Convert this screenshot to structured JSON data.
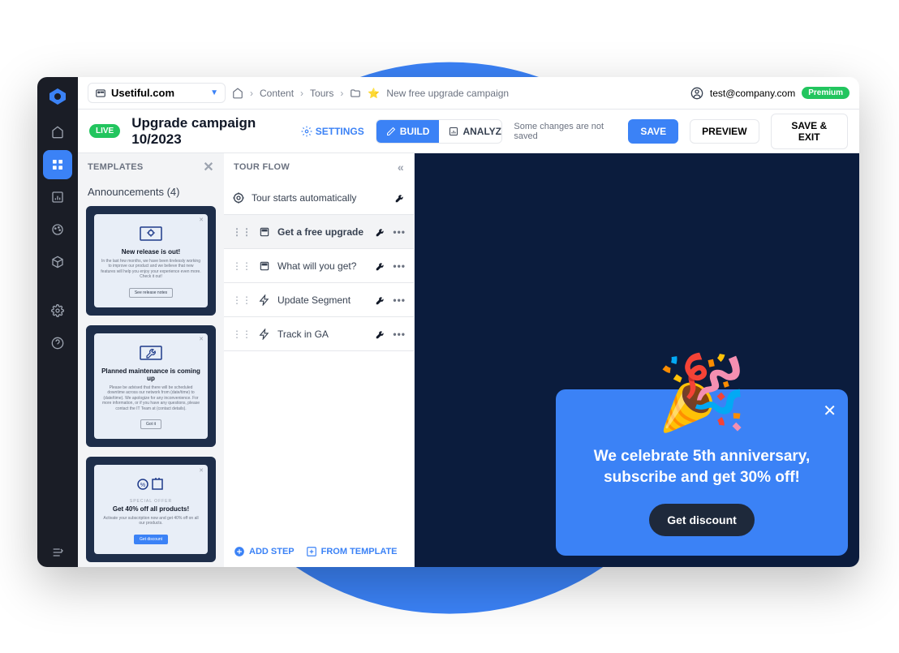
{
  "topbar": {
    "site": "Usetiful.com",
    "breadcrumb": {
      "content": "Content",
      "tours": "Tours",
      "page": "New free upgrade campaign"
    },
    "user": "test@company.com",
    "premium": "Premium"
  },
  "header": {
    "live": "LIVE",
    "title": "Upgrade campaign 10/2023",
    "settings": "SETTINGS",
    "build": "BUILD",
    "analyze": "ANALYZE",
    "unsaved": "Some changes are not saved",
    "save": "SAVE",
    "preview": "PREVIEW",
    "saveExit": "SAVE & EXIT"
  },
  "templates": {
    "header": "TEMPLATES",
    "category": "Announcements (4)",
    "items": [
      {
        "title": "New release is out!",
        "desc": "In the last few months, we have been tirelessly working to improve our product and we believe that new features will help you enjoy your experience even more. Check it out!",
        "btn": "See release notes",
        "style": "outline"
      },
      {
        "title": "Planned maintenance is coming up",
        "desc": "Please be advised that there will be scheduled downtime across our network from (date/time) to (date/time). We apologize for any inconvenience. For more information, or if you have any questions, please contact the IT Team at (contact details).",
        "btn": "Got it",
        "style": "outline"
      },
      {
        "title": "Get 40% off all products!",
        "desc": "Activate your subscription now and get 40% off on all our products.",
        "btn": "Get discount",
        "style": "blue",
        "tag": "SPECIAL OFFER"
      }
    ]
  },
  "flow": {
    "header": "TOUR FLOW",
    "start": "Tour starts automatically",
    "steps": [
      {
        "label": "Get a free upgrade",
        "icon": "page",
        "selected": true
      },
      {
        "label": "What will you get?",
        "icon": "page",
        "selected": false
      },
      {
        "label": "Update Segment",
        "icon": "bolt",
        "selected": false
      },
      {
        "label": "Track in GA",
        "icon": "bolt",
        "selected": false
      }
    ],
    "addStep": "ADD STEP",
    "fromTemplate": "FROM TEMPLATE"
  },
  "promo": {
    "text": "We celebrate 5th anniversary, subscribe and get 30% off!",
    "button": "Get discount"
  }
}
